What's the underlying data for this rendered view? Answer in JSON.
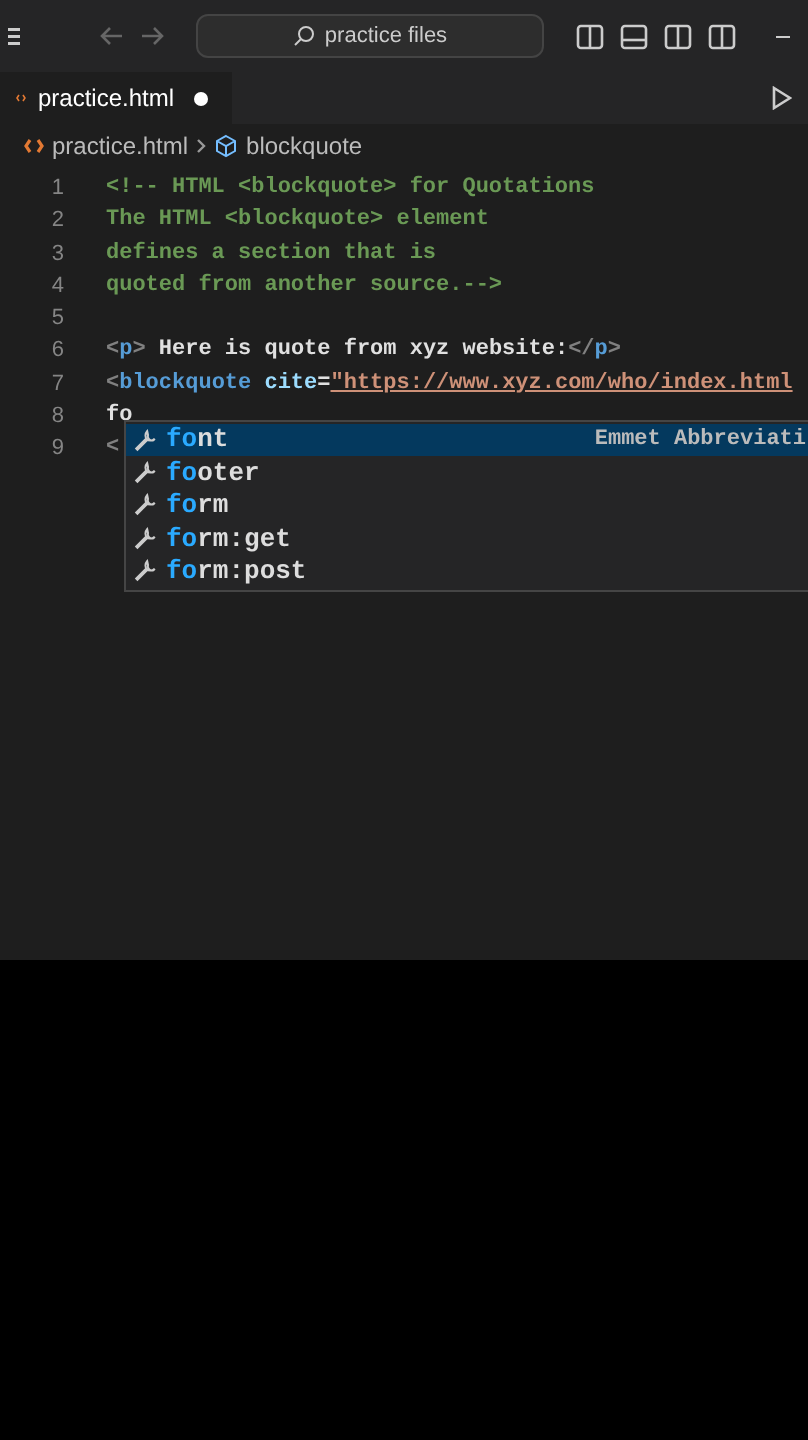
{
  "title_bar": {
    "search": "practice files"
  },
  "tab": {
    "label": "practice.html",
    "modified": true
  },
  "breadcrumb": [
    "practice.html",
    "blockquote"
  ],
  "lines": [
    {
      "number": "1",
      "tokens": [
        {
          "kind": "comment",
          "text": "<!-- HTML <blockquote> for Quotations"
        }
      ]
    },
    {
      "number": "2",
      "tokens": [
        {
          "kind": "comment",
          "text": "The HTML <blockquote> element"
        }
      ]
    },
    {
      "number": "3",
      "tokens": [
        {
          "kind": "comment",
          "text": "defines a section that is"
        }
      ]
    },
    {
      "number": "4",
      "tokens": [
        {
          "kind": "comment",
          "text": "quoted from another source.-->"
        }
      ]
    },
    {
      "number": "5"
    },
    {
      "number": "6",
      "tokens": [
        {
          "kind": "punct",
          "text": "<"
        },
        {
          "kind": "tag",
          "text": "p"
        },
        {
          "kind": "punct",
          "text": ">"
        },
        {
          "kind": "text",
          "text": " Here is quote from xyz website:"
        },
        {
          "kind": "punct",
          "text": "</"
        },
        {
          "kind": "tag",
          "text": "p"
        },
        {
          "kind": "punct",
          "text": ">"
        }
      ]
    },
    {
      "number": "7",
      "tokens": [
        {
          "kind": "punct",
          "text": "<"
        },
        {
          "kind": "tag",
          "text": "blockquote"
        },
        {
          "kind": "attr",
          "text": " cite"
        },
        {
          "kind": "text",
          "text": "="
        },
        {
          "kind": "string",
          "text": "\"https://www.xyz.com/who/index.html"
        }
      ]
    },
    {
      "number": "8",
      "tokens": [
        {
          "kind": "text",
          "text": "fo"
        }
      ]
    },
    {
      "number": "9",
      "tokens": [
        {
          "kind": "punct",
          "text": "<"
        }
      ]
    }
  ],
  "suggestions": [
    {
      "match": "fo",
      "rest": "nt",
      "detail": "Emmet Abbreviati",
      "selected": true
    },
    {
      "match": "fo",
      "rest": "oter",
      "selected": false
    },
    {
      "match": "fo",
      "rest": "rm",
      "selected": false
    },
    {
      "match": "fo",
      "rest": "rm:get",
      "selected": false
    },
    {
      "match": "fo",
      "rest": "rm:post",
      "selected": false
    }
  ]
}
